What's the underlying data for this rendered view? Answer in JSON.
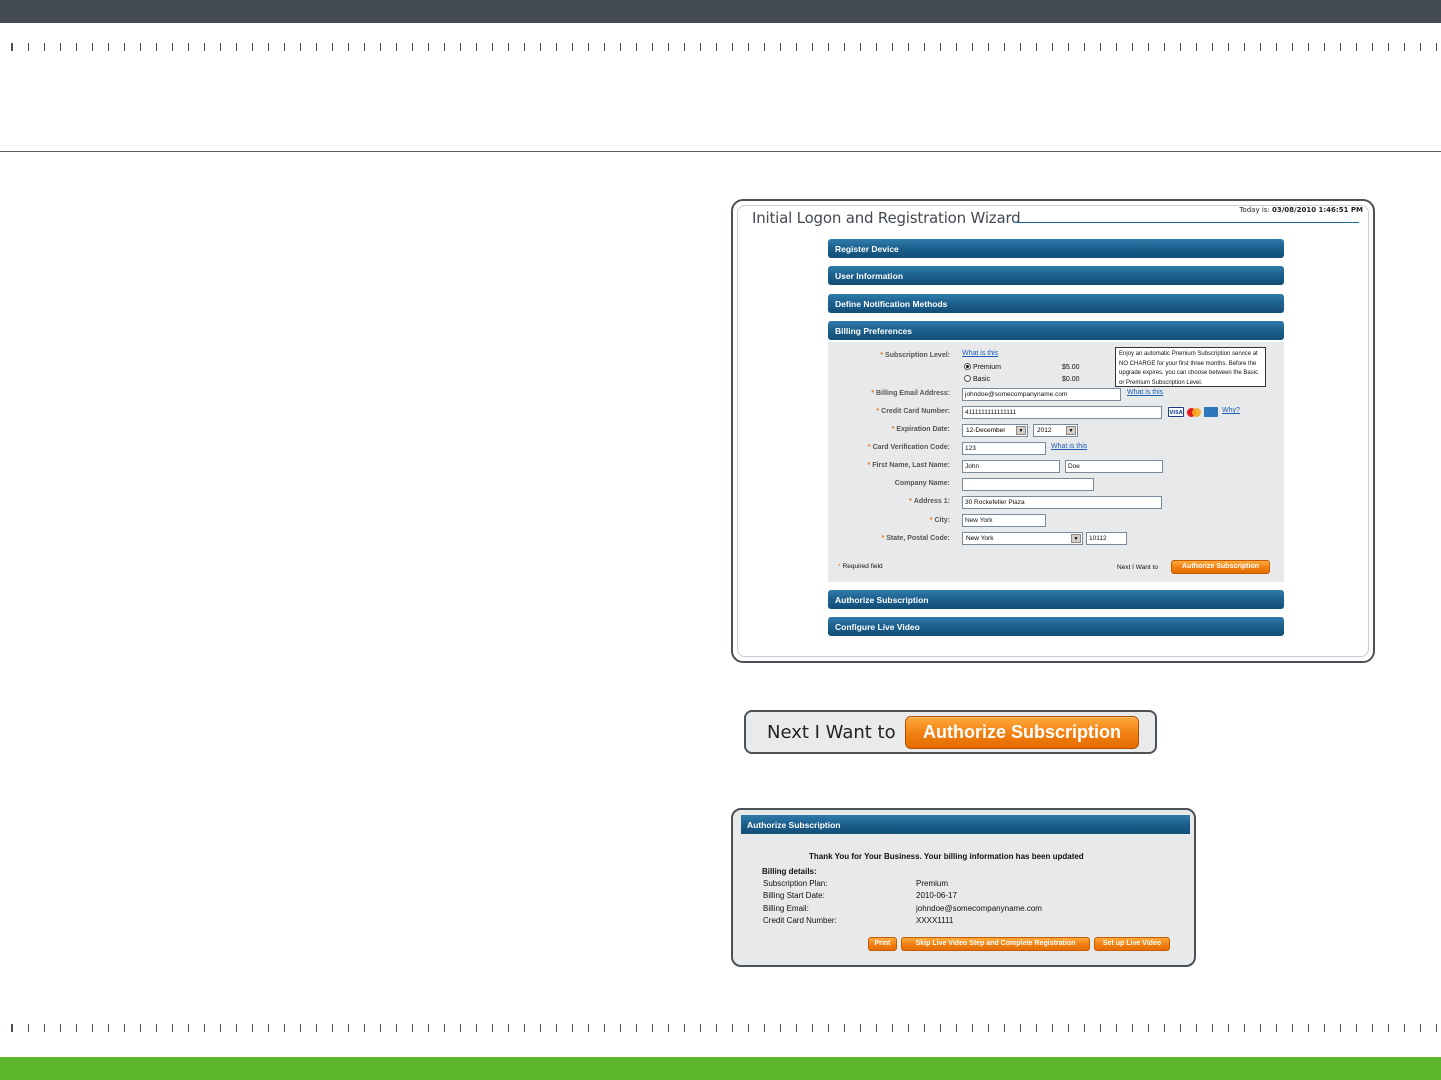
{
  "wizard": {
    "title": "Initial Logon and Registration Wizard",
    "today_label": "Today is: ",
    "today_value": "03/08/2010 1:46:51 PM",
    "sections": {
      "register_device": "Register Device",
      "user_information": "User Information",
      "define_notification": "Define Notification Methods",
      "billing_preferences": "Billing Preferences",
      "authorize_subscription": "Authorize Subscription",
      "configure_live_video": "Configure Live Video"
    },
    "billing": {
      "subscription_level_label": "Subscription Level:",
      "what_is_this": "What is this",
      "premium_label": "Premium",
      "premium_price": "$5.00",
      "basic_label": "Basic",
      "basic_price": "$0.00",
      "selected_level": "Premium",
      "tooltip": "Enjoy an automatic Premium Subscription service at NO CHARGE for your first three months. Before the upgrade expires, you can choose between the Basic or Premium Subscription Level.",
      "billing_email_label": "Billing Email Address:",
      "billing_email_value": "johndoe@somecompanyname.com",
      "cc_number_label": "Credit Card Number:",
      "cc_number_value": "4111111111111111",
      "card_icons": [
        "VISA",
        "MC",
        "AMEX"
      ],
      "why_link": "Why?",
      "expiration_label": "Expiration Date:",
      "exp_month": "12-December",
      "exp_year": "2012",
      "cvc_label": "Card Verification Code:",
      "cvc_value": "123",
      "name_label": "First Name, Last Name:",
      "first_name": "John",
      "last_name": "Doe",
      "company_label": "Company Name:",
      "company_value": "",
      "address_label": "Address 1:",
      "address_value": "30 Rockefeller Plaza",
      "city_label": "City:",
      "city_value": "New York",
      "state_label": "State, Postal Code:",
      "state_value": "New York",
      "postal_value": "10112",
      "required_note": "Required field",
      "next_label": "Next I Want to",
      "authorize_button": "Authorize Subscription"
    }
  },
  "zoom": {
    "next_label": "Next I Want to",
    "authorize_button": "Authorize Subscription"
  },
  "confirmation": {
    "header": "Authorize Subscription",
    "thanks": "Thank You for Your Business. Your billing information has been updated",
    "details_label": "Billing details:",
    "rows": [
      {
        "label": "Subscription Plan:",
        "value": "Premium"
      },
      {
        "label": "Billing Start Date:",
        "value": "2010-06-17"
      },
      {
        "label": "Billing Email:",
        "value": "johndoe@somecompanyname.com"
      },
      {
        "label": "Credit Card Number:",
        "value": "XXXX1111"
      }
    ],
    "buttons": {
      "print": "Print",
      "skip": "Skip Live Video Step and Complete Registration",
      "setup": "Set up Live Video"
    }
  },
  "colors": {
    "top_bar": "#454b53",
    "bottom_bar": "#5cb52a",
    "section_bar": "#1b5f8c",
    "button_orange": "#f17f10"
  }
}
